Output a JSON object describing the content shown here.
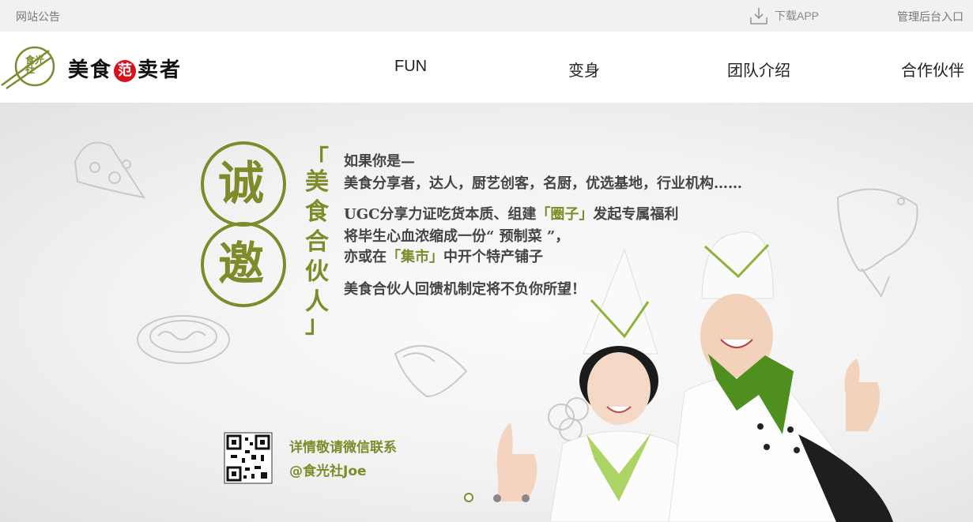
{
  "topbar": {
    "notice": "网站公告",
    "download_label": "下载APP",
    "admin_label": "管理后台入口"
  },
  "header": {
    "logo_seal_text": "食光社",
    "brand_name_1": "美食",
    "brand_name_badge": "范",
    "brand_name_2": "卖者",
    "nav": [
      "FUN",
      "变身",
      "团队介绍",
      "合作伙伴"
    ]
  },
  "banner": {
    "invite_chars": [
      "诚",
      "邀"
    ],
    "bracket_left": "「",
    "bracket_right": "」",
    "partner_chars": [
      "美",
      "食",
      "合",
      "伙",
      "人"
    ],
    "line1": "如果你是—",
    "line2": "美食分享者，达人，厨艺创客，名厨，优选基地，行业机构……",
    "line3_a": "UGC分享力证吃货本质、组建",
    "line3_hl": "「圈子」",
    "line3_b": "发起专属福利",
    "line4": "将毕生心血浓缩成一份“ 预制菜 ”，",
    "line5_a": "亦或在",
    "line5_hl": "「集市」",
    "line5_b": "中开个特产铺子",
    "line6": "美食合伙人回馈机制定将不负你所望！",
    "contact_line1": "详情敬请微信联系",
    "contact_line2": "@食光社Joe",
    "slide_count": 3,
    "active_slide": 1
  },
  "colors": {
    "accent_olive": "#7f8b2a",
    "brand_red": "#d8121c",
    "topbar_bg": "#f1f1f1",
    "chef_green": "#4f8f1f"
  },
  "icons": {
    "download": "download-icon",
    "logo": "chopsticks-seal-logo"
  }
}
